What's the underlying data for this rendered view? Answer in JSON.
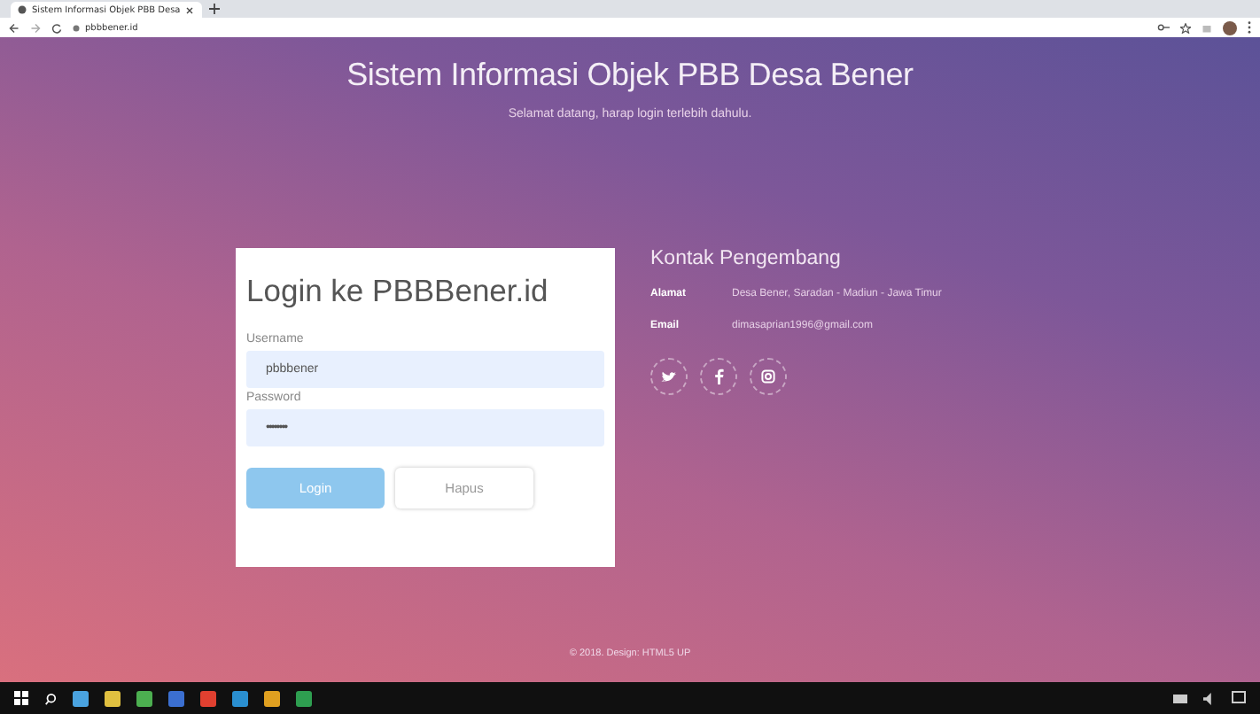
{
  "browser": {
    "tab_title": "Sistem Informasi Objek PBB Desa",
    "address": "pbbbener.id"
  },
  "header": {
    "title": "Sistem Informasi Objek PBB Desa Bener",
    "subtitle": "Selamat datang, harap login terlebih dahulu."
  },
  "login": {
    "title": "Login ke PBBBener.id",
    "fields": [
      {
        "label": "Username",
        "value": "pbbbener",
        "kind": "text"
      },
      {
        "label": "Password",
        "value": "••••••••",
        "kind": "password"
      }
    ],
    "buttons": [
      {
        "label": "Login",
        "kind": "primary"
      },
      {
        "label": "Hapus",
        "kind": "secondary"
      }
    ]
  },
  "contact": {
    "title": "Kontak Pengembang",
    "rows": [
      {
        "label": "Alamat",
        "value": "Desa Bener, Saradan - Madiun - Jawa Timur"
      },
      {
        "label": "Email",
        "value": "dimasaprian1996@gmail.com"
      }
    ],
    "social": [
      {
        "kind": "twitter"
      },
      {
        "kind": "facebook"
      },
      {
        "kind": "instagram"
      }
    ]
  },
  "footer": {
    "text": "© 2018. Design: HTML5 UP"
  }
}
